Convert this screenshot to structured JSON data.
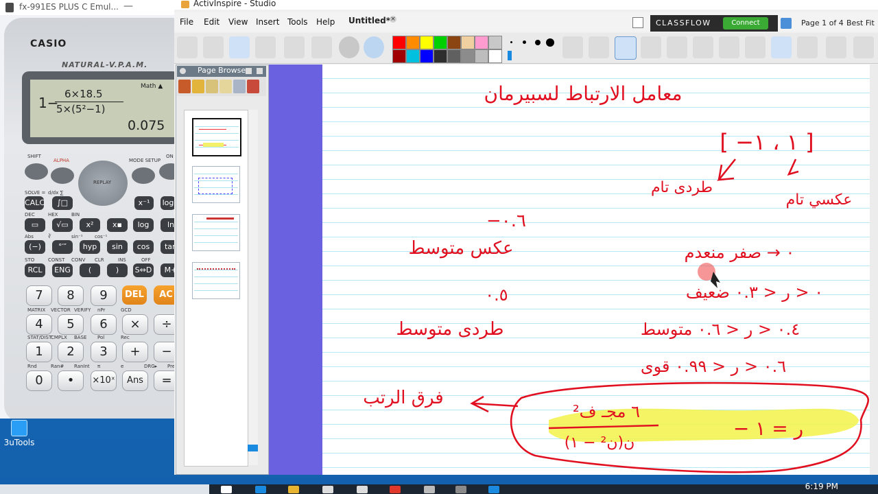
{
  "desktop": {
    "icon_label": "3uTools"
  },
  "taskbar": {
    "time": "6:19 PM"
  },
  "calculator": {
    "window_title": "fx-991ES PLUS C Emul...",
    "minimize": "—",
    "brand": "CASIO",
    "model_tag": "NATURAL-V.P.A.M.",
    "lcd": {
      "mode": "Math ▲",
      "leading": "1−",
      "numerator": "6×18.5",
      "denominator": "5×(5²−1)",
      "result": "0.075"
    },
    "top_labels": {
      "shift": "SHIFT",
      "alpha": "ALPHA",
      "mode": "MODE SETUP",
      "on": "ON",
      "replay": "REPLAY"
    },
    "fn_rows": [
      [
        "CALC",
        "∫□",
        "x⁻¹",
        "log"
      ],
      [
        "▭",
        "√▭",
        "x²",
        "x▪",
        "log",
        "ln"
      ],
      [
        "(−)",
        "°′″",
        "hyp",
        "sin",
        "cos",
        "tan"
      ],
      [
        "RCL",
        "ENG",
        "(",
        ")",
        "S⇔D",
        "M+"
      ]
    ],
    "fn_row_labels": [
      [
        "SOLVE =",
        "d/dx ∑"
      ],
      [
        "DEC",
        "HEX",
        "BIN"
      ],
      [
        "Abs",
        "∛",
        "sin⁻¹",
        "cos⁻¹"
      ],
      [
        "STO",
        "CONST",
        "CONV",
        "CLR",
        "INS",
        "OFF"
      ]
    ],
    "num_rows": [
      [
        "7",
        "8",
        "9",
        "DEL",
        "AC"
      ],
      [
        "4",
        "5",
        "6",
        "×",
        "÷"
      ],
      [
        "1",
        "2",
        "3",
        "+",
        "−"
      ],
      [
        "0",
        "•",
        "×10ˣ",
        "Ans",
        "="
      ]
    ],
    "num_row_labels": [
      [
        "MATRIX",
        "VECTOR",
        "VERIFY",
        "nPr",
        "GCD"
      ],
      [
        "STAT/DIST",
        "CMPLX",
        "BASE",
        "Pol",
        "Rec"
      ],
      [
        "Rnd",
        "Ran#",
        "RanInt",
        "π",
        "e",
        "DRG▸",
        "PreAns"
      ]
    ]
  },
  "app": {
    "window_title": "ActivInspire - Studio",
    "menus": [
      "File",
      "Edit",
      "View",
      "Insert",
      "Tools",
      "Help"
    ],
    "tab_label": "Untitled*",
    "tab_close": "×",
    "classflow": "CLASSFLOW",
    "connect": "Connect",
    "page_indicator": "Page 1 of 4",
    "zoom": "Best Fit",
    "palette": [
      "#ff0000",
      "#ff8c00",
      "#ffff00",
      "#00d000",
      "#8b4513",
      "#f0d0a0",
      "#ff9ccf",
      "#c8c8c8",
      "#a00000",
      "#00c0e0",
      "#0000ff",
      "#2e2e2e",
      "#606060",
      "#8c8c8c",
      "#bdbdbd",
      "#ffffff"
    ],
    "page_browser": {
      "title": "Page Browser",
      "page_count": 4
    }
  },
  "flipchart": {
    "heading": "معامل الارتباط لسبيرمان",
    "range": "[ −١ ، ١ ]",
    "label_direct_full": "طردی تام",
    "label_inverse_full": "عكسي تام",
    "zero_row": "٠ → صفر      منعدم",
    "val_minus_06": "−٠.٦",
    "label_inverse_medium": "عكس متوسط",
    "weak_row": "٠ < ر < ٠.٣    ضعيف",
    "val_05": "٠.٥",
    "label_direct_medium": "طردى متوسط",
    "medium_row": "٠.٤ < ر < ٠.٦    متوسط",
    "strong_row": "٠.٦ < ر < ٠.٩٩    قوى",
    "formula_label": "فرق الرتب",
    "formula_numerator": "٦ مجـ ف²",
    "formula_denominator": "ن(ن² − ١)",
    "formula_right": "ر = ١ −"
  }
}
